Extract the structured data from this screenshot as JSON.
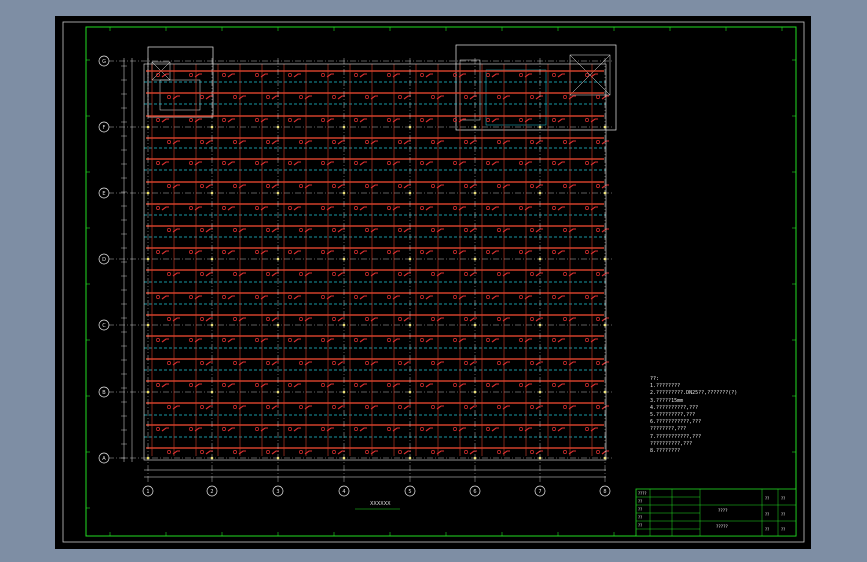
{
  "colors": {
    "background": "#7e8ea4",
    "sheet": "#000000",
    "frame": "#22dd22",
    "outer_frame": "#c8c8c8",
    "pipe": "#d0402a",
    "branch": "#e03030",
    "dashed_line": "#22c8d8",
    "node": "#f0e040",
    "gridline": "#e8e8e8",
    "text": "#e0e0e0"
  },
  "grid": {
    "column_labels": [
      "1",
      "2",
      "3",
      "4",
      "5",
      "6",
      "7",
      "8"
    ],
    "row_labels": [
      "G",
      "F",
      "E",
      "D",
      "C",
      "B",
      "A"
    ]
  },
  "drawing_caption": "XXXXXX",
  "notes": {
    "heading": "??:",
    "lines": [
      "1.????????",
      "2.?????????.DN25??,???????(?)",
      "3.?????15mm",
      "4.??????????,???",
      "5.?????????,???",
      "6.???????????,???",
      "   ????????,???",
      "7.???????????,???",
      "   ??????????,???",
      "8.????????"
    ]
  },
  "title_block": {
    "rows": [
      "????",
      "??",
      "??",
      "??",
      "??"
    ],
    "project": "????",
    "sheet_name": "?????",
    "labels": [
      "??",
      "??",
      "??"
    ],
    "values": [
      "??",
      "??",
      "??"
    ]
  }
}
